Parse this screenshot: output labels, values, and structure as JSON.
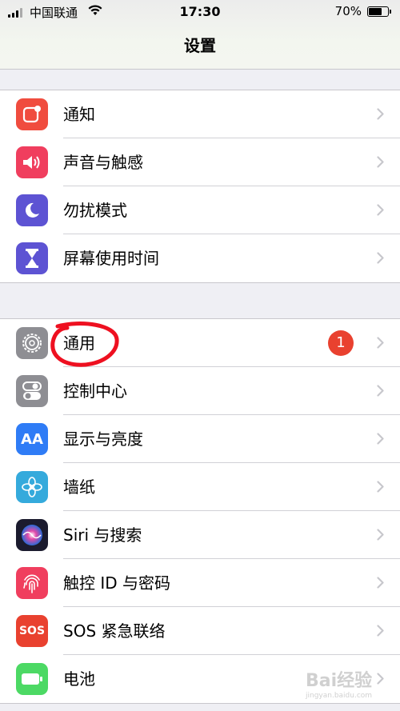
{
  "status_bar": {
    "carrier": "中国联通",
    "time": "17:30",
    "battery": "70%"
  },
  "nav": {
    "title": "设置"
  },
  "groups": [
    [
      {
        "label": "通知",
        "icon": "notifications-icon",
        "color": "#f04c3e"
      },
      {
        "label": "声音与触感",
        "icon": "sound-icon",
        "color": "#f03e5e"
      },
      {
        "label": "勿扰模式",
        "icon": "moon-icon",
        "color": "#5d53d3"
      },
      {
        "label": "屏幕使用时间",
        "icon": "hourglass-icon",
        "color": "#5d53d3"
      }
    ],
    [
      {
        "label": "通用",
        "icon": "gear-icon",
        "color": "#8e8e93",
        "badge": "1"
      },
      {
        "label": "控制中心",
        "icon": "toggles-icon",
        "color": "#8e8e93"
      },
      {
        "label": "显示与亮度",
        "icon": "text-size-icon",
        "text": "AA",
        "color": "#2f7cf6"
      },
      {
        "label": "墙纸",
        "icon": "flower-icon",
        "color": "#35aadc"
      },
      {
        "label": "Siri 与搜索",
        "icon": "siri-icon",
        "color": "#1b1b2e"
      },
      {
        "label": "触控 ID 与密码",
        "icon": "fingerprint-icon",
        "color": "#f03e5e"
      },
      {
        "label": "SOS 紧急联络",
        "icon": "sos-icon",
        "text": "SOS",
        "color": "#e9412f"
      },
      {
        "label": "电池",
        "icon": "battery-icon",
        "color": "#4cd964"
      }
    ]
  ],
  "watermark": {
    "text": "Bai经验",
    "sub": "jingyan.baidu.com"
  }
}
